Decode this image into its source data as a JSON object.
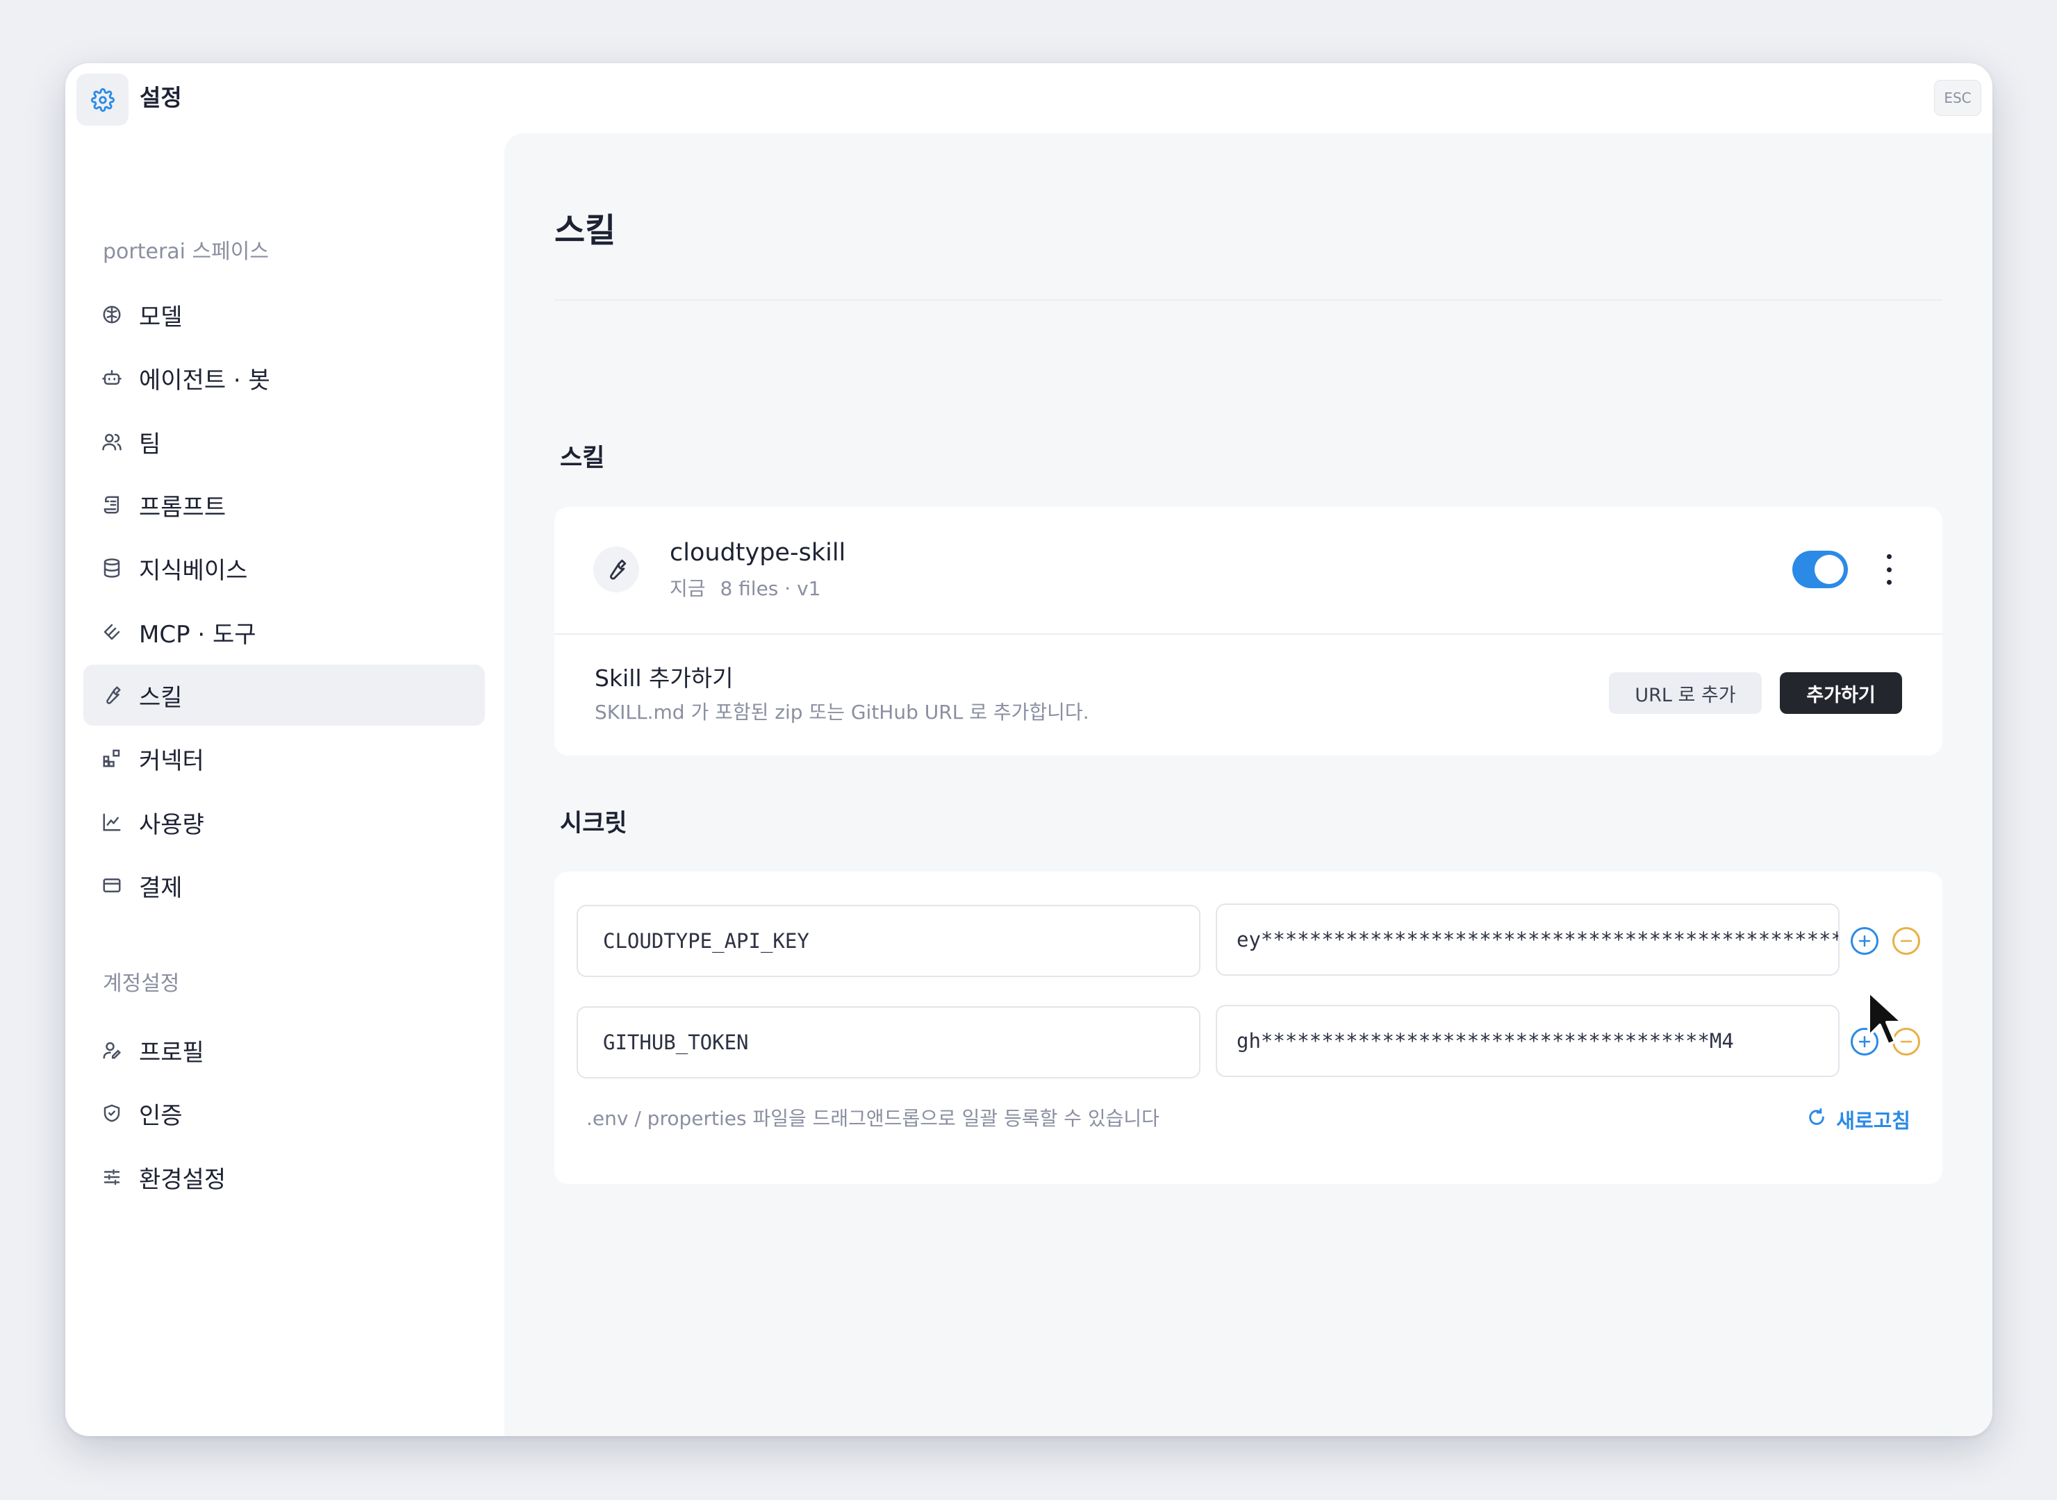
{
  "window": {
    "title": "설정",
    "esc_label": "ESC"
  },
  "sidebar": {
    "workspace_label": "porterai 스페이스",
    "workspace_items": [
      {
        "label": "모델",
        "icon": "brain-icon"
      },
      {
        "label": "에이전트 · 봇",
        "icon": "bot-icon"
      },
      {
        "label": "팀",
        "icon": "users-icon"
      },
      {
        "label": "프롬프트",
        "icon": "scroll-icon"
      },
      {
        "label": "지식베이스",
        "icon": "database-icon"
      },
      {
        "label": "MCP · 도구",
        "icon": "tool-stack-icon"
      },
      {
        "label": "스킬",
        "icon": "wrench-icon",
        "active": true
      },
      {
        "label": "커넥터",
        "icon": "blocks-icon"
      },
      {
        "label": "사용량",
        "icon": "chart-line-icon"
      },
      {
        "label": "결제",
        "icon": "credit-card-icon"
      }
    ],
    "account_label": "계정설정",
    "account_items": [
      {
        "label": "프로필",
        "icon": "user-pen-icon"
      },
      {
        "label": "인증",
        "icon": "shield-check-icon"
      },
      {
        "label": "환경설정",
        "icon": "sliders-icon"
      }
    ]
  },
  "main": {
    "page_title": "스킬",
    "skills_section": {
      "label": "스킬",
      "skill": {
        "name": "cloudtype-skill",
        "time": "지금",
        "meta": "8 files · v1",
        "enabled": true
      },
      "add": {
        "title": "Skill 추가하기",
        "description": "SKILL.md 가 포함된 zip 또는 GitHub URL 로 추가합니다.",
        "url_button": "URL 로 추가",
        "add_button": "추가하기"
      }
    },
    "secrets_section": {
      "label": "시크릿",
      "rows": [
        {
          "key": "CLOUDTYPE_API_KEY",
          "value": "ey***************************************************"
        },
        {
          "key": "GITHUB_TOKEN",
          "value": "gh*************************************M4"
        }
      ],
      "hint": ".env / properties 파일을 드래그앤드롭으로 일괄 등록할 수 있습니다",
      "refresh_label": "새로고침"
    }
  },
  "colors": {
    "accent": "#2b8ae6",
    "warning": "#e8b044",
    "dark_button": "#24262d"
  }
}
